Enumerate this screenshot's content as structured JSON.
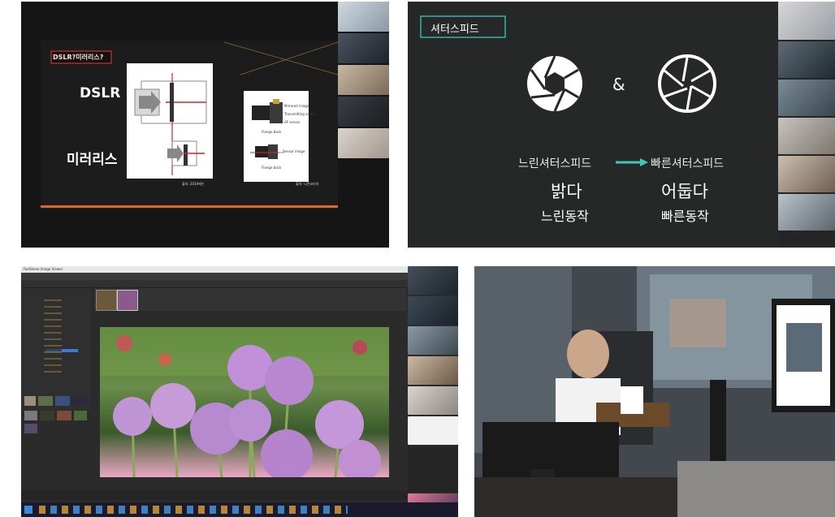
{
  "panel1": {
    "slide_title": "DSLR?미러리스?",
    "label_dslr": "DSLR",
    "label_mirrorless": "미러리스",
    "diagram_labels": [
      "Mirrored image",
      "Transmitting screen",
      "AF sensor",
      "Flange back",
      "Sensor image",
      "Flange back"
    ],
    "credit_left": "출처: 2019캐논",
    "credit_right": "출처: 니콘코리아"
  },
  "panel2": {
    "slide_title": "셔터스피드",
    "ampersand": "&",
    "slow_label": "느린셔터스피드",
    "fast_label": "빠른셔터스피드",
    "slow_word1": "밝다",
    "slow_word2": "느린동작",
    "fast_word1": "어둡다",
    "fast_word2": "빠른동작"
  },
  "panel3": {
    "app_title": "FastStone Image Viewer"
  },
  "colors": {
    "teal": "#3cc7b8",
    "slide_red": "#c0392b",
    "accent_orange": "#e0662a"
  }
}
